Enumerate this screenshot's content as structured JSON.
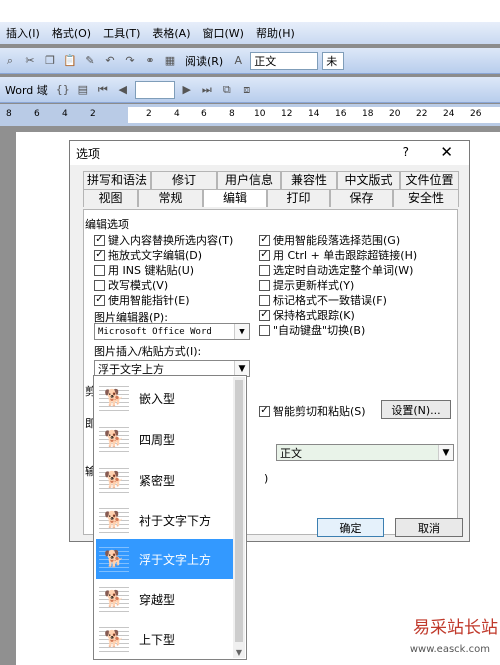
{
  "menubar": [
    "插入(I)",
    "格式(O)",
    "工具(T)",
    "表格(A)",
    "窗口(W)",
    "帮助(H)"
  ],
  "toolbar1": {
    "read_label": "阅读(R)",
    "style_value": "正文",
    "font_value": "未"
  },
  "toolbar2": {
    "word_field": "Word 域"
  },
  "ruler": [
    "8",
    "6",
    "4",
    "2",
    "2",
    "4",
    "6",
    "8",
    "10",
    "12",
    "14",
    "16",
    "18",
    "20",
    "22",
    "24",
    "26"
  ],
  "dialog": {
    "title": "选项",
    "help": "?",
    "close": "✕",
    "tabs_row1": [
      "拼写和语法",
      "修订",
      "用户信息",
      "兼容性",
      "中文版式",
      "文件位置"
    ],
    "tabs_row2": [
      "视图",
      "常规",
      "编辑",
      "打印",
      "保存",
      "安全性"
    ],
    "section_edit": "编辑选项",
    "left_options": [
      {
        "label": "键入内容替换所选内容(T)",
        "checked": true
      },
      {
        "label": "拖放式文字编辑(D)",
        "checked": true
      },
      {
        "label": "用 INS 键粘贴(U)",
        "checked": false
      },
      {
        "label": "改写模式(V)",
        "checked": false
      },
      {
        "label": "使用智能指针(E)",
        "checked": true
      }
    ],
    "right_options": [
      {
        "label": "使用智能段落选择范围(G)",
        "checked": true
      },
      {
        "label": "用 Ctrl + 单击跟踪超链接(H)",
        "checked": true
      },
      {
        "label": "选定时自动选定整个单词(W)",
        "checked": false
      },
      {
        "label": "提示更新样式(Y)",
        "checked": false
      },
      {
        "label": "标记格式不一致错误(F)",
        "checked": false
      },
      {
        "label": "保持格式跟踪(K)",
        "checked": true
      },
      {
        "label": "\"自动键盘\"切换(B)",
        "checked": false
      }
    ],
    "picture_editor_label": "图片编辑器(P):",
    "picture_editor_value": "Microsoft Office Word",
    "insert_paste_label": "图片插入/粘贴方式(I):",
    "insert_paste_value": "浮于文字上方",
    "cut_label": "剪",
    "cond_label": "即",
    "input_label": "输",
    "smart_cut_label": "智能剪切和粘贴(S)",
    "smart_cut_checked": true,
    "settings_button": "设置(N)...",
    "style_value": "正文",
    "paren_text": ")",
    "ok_button": "确定",
    "cancel_button": "取消"
  },
  "dropdown_items": [
    {
      "label": "嵌入型",
      "selected": false
    },
    {
      "label": "四周型",
      "selected": false
    },
    {
      "label": "紧密型",
      "selected": false
    },
    {
      "label": "衬于文字下方",
      "selected": false
    },
    {
      "label": "浮于文字上方",
      "selected": true
    },
    {
      "label": "穿越型",
      "selected": false
    },
    {
      "label": "上下型",
      "selected": false
    }
  ],
  "watermark": {
    "title": "易采站长站",
    "url": "www.easck.com"
  }
}
